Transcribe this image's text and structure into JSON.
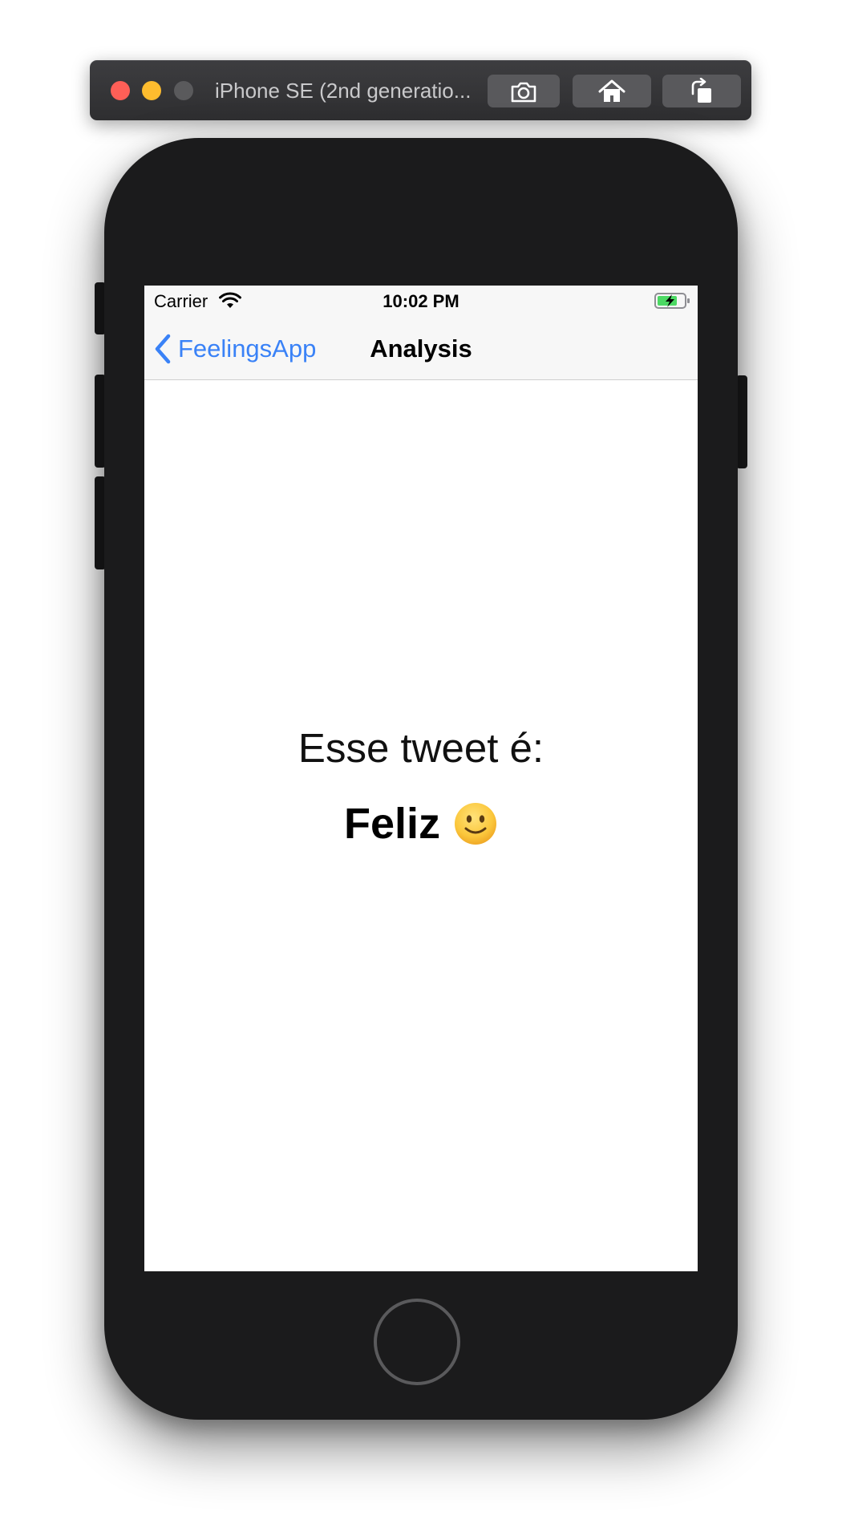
{
  "simulator": {
    "title": "iPhone SE (2nd generatio...",
    "toolbar_icons": [
      "screenshot-icon",
      "home-icon",
      "rotate-icon"
    ]
  },
  "status_bar": {
    "carrier": "Carrier",
    "time": "10:02 PM",
    "battery_charging": true
  },
  "nav": {
    "back_label": "FeelingsApp",
    "title": "Analysis"
  },
  "content": {
    "prompt": "Esse tweet é:",
    "result": "Feliz",
    "result_emoji": "slightly-smiling-face-icon"
  },
  "colors": {
    "accent": "#3a82f7",
    "device": "#1b1b1c",
    "battery_green": "#4cd964"
  }
}
